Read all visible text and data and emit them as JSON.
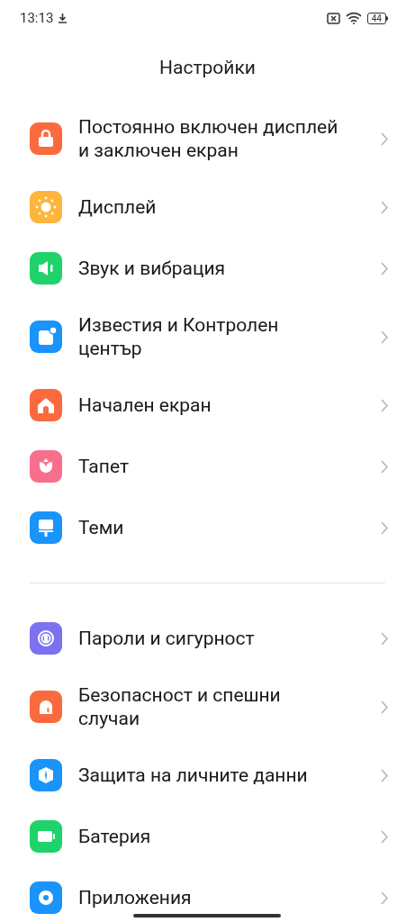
{
  "status_bar": {
    "time": "13:13",
    "battery": "44"
  },
  "title": "Настройки",
  "sections": [
    {
      "items": [
        {
          "label": "Постоянно включен дисплей и заключен екран",
          "kind": "lock",
          "color": "#fb6a3e"
        },
        {
          "label": "Дисплей",
          "kind": "sun",
          "color": "#fdb53c"
        },
        {
          "label": "Звук и вибрация",
          "kind": "speaker",
          "color": "#1fd36a"
        },
        {
          "label": "Известия и Контролен център",
          "kind": "notification",
          "color": "#1a93fb"
        },
        {
          "label": "Начален екран",
          "kind": "home",
          "color": "#fb6a3e"
        },
        {
          "label": "Тапет",
          "kind": "flower",
          "color": "#f86f8e"
        },
        {
          "label": "Теми",
          "kind": "brush",
          "color": "#1a93fb"
        }
      ]
    },
    {
      "items": [
        {
          "label": "Пароли и сигурност",
          "kind": "fingerprint",
          "color": "#7a72f0"
        },
        {
          "label": "Безопасност и спешни случаи",
          "kind": "siren",
          "color": "#fb6a3e"
        },
        {
          "label": "Защита на личните данни",
          "kind": "shield",
          "color": "#1a93fb"
        },
        {
          "label": "Батерия",
          "kind": "battery",
          "color": "#1fd36a"
        },
        {
          "label": "Приложения",
          "kind": "gear",
          "color": "#1a93fb"
        }
      ]
    }
  ]
}
